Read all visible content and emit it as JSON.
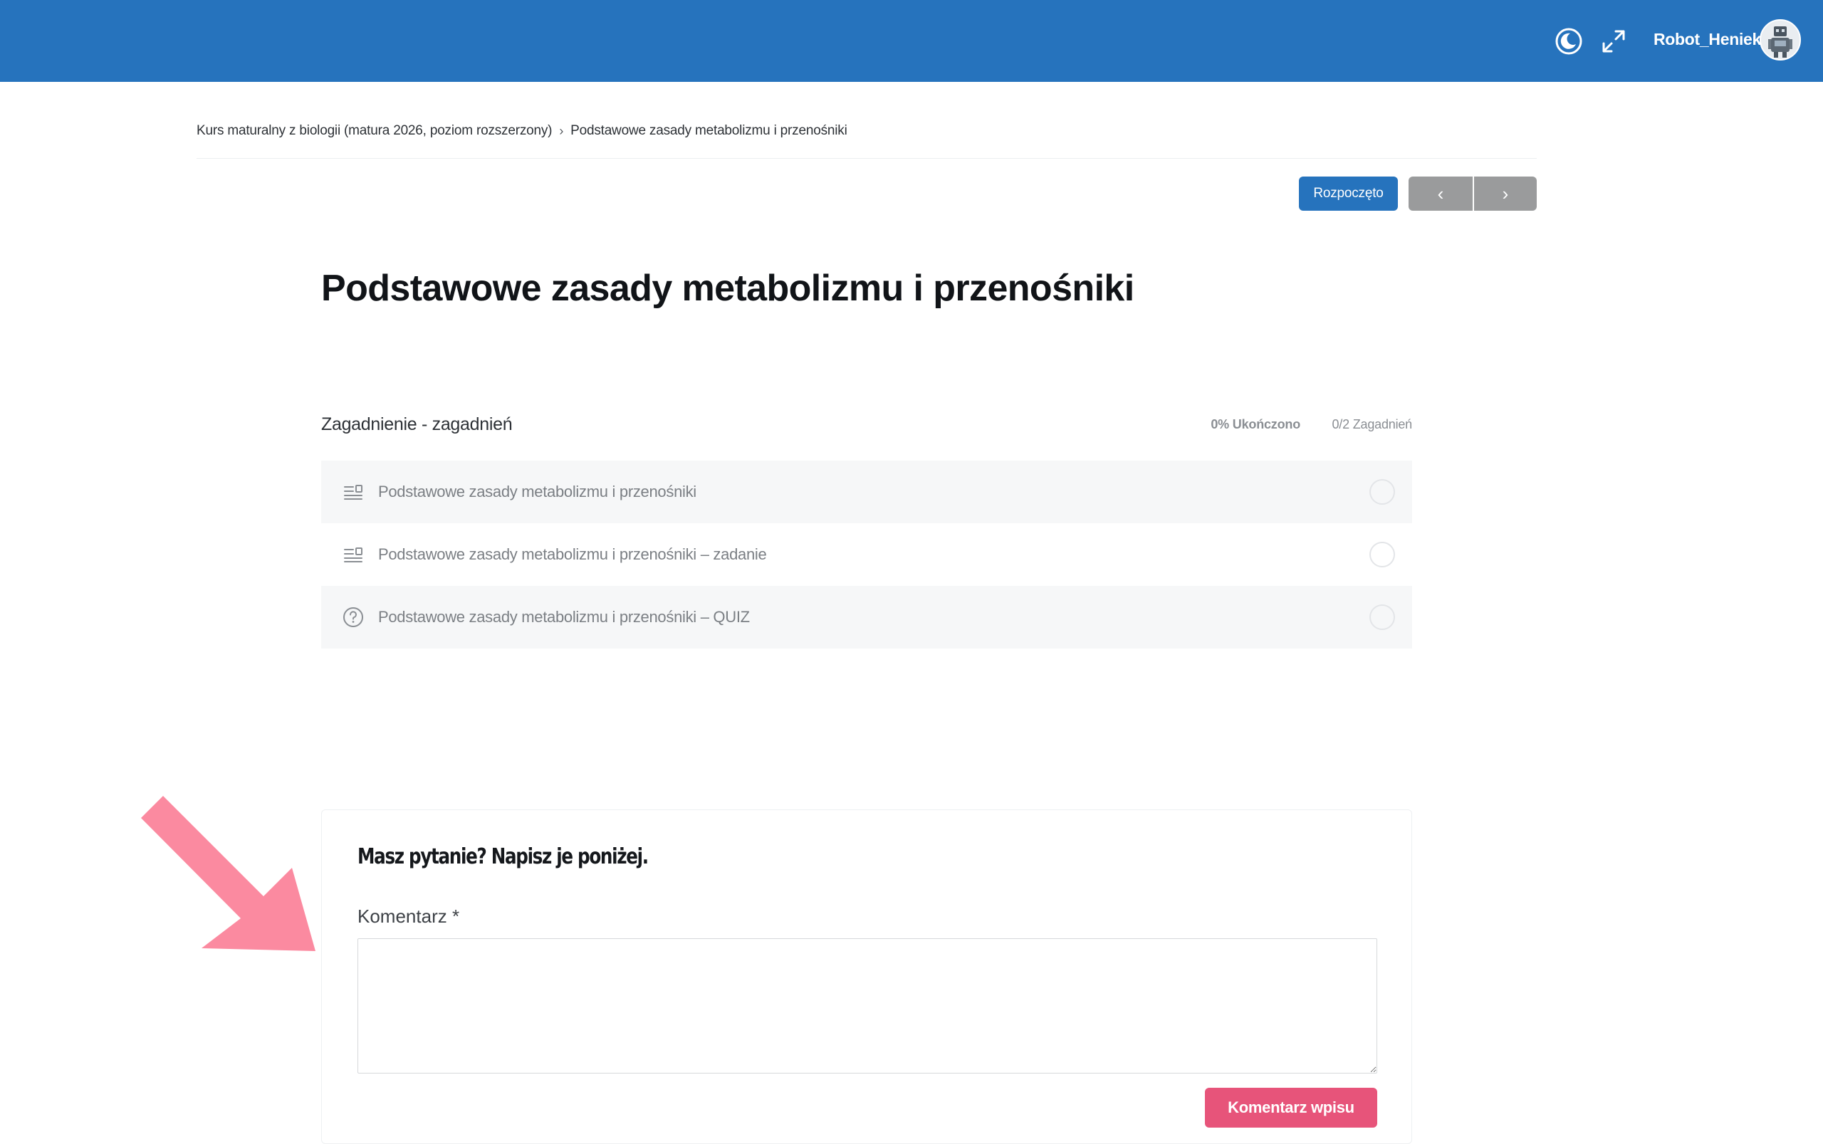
{
  "topbar": {
    "username": "Robot_Heniek",
    "icons": [
      "moon-icon",
      "expand-icon",
      "avatar"
    ],
    "background": "#2673bd"
  },
  "breadcrumb": {
    "course": "Kurs maturalny z biologii (matura 2026, poziom rozszerzony)",
    "separator": "›",
    "lesson": "Podstawowe zasady metabolizmu i przenośniki"
  },
  "actions": {
    "status_label": "Rozpoczęto",
    "prev_symbol": "‹",
    "next_symbol": "›"
  },
  "lesson": {
    "title": "Podstawowe zasady metabolizmu i przenośniki"
  },
  "topics": {
    "heading": "Zagadnienie - zagadnień",
    "progress": "0% Ukończono",
    "count": "0/2 Zagadnień",
    "items": [
      {
        "label": "Podstawowe zasady metabolizmu i przenośniki",
        "icon": "lesson-text-icon",
        "completed": false
      },
      {
        "label": "Podstawowe zasady metabolizmu i przenośniki – zadanie",
        "icon": "lesson-text-icon",
        "completed": false
      },
      {
        "label": "Podstawowe zasady metabolizmu i przenośniki – QUIZ",
        "icon": "quiz-question-icon",
        "completed": false
      }
    ]
  },
  "comment": {
    "heading": "Masz pytanie? Napisz je poniżej.",
    "label": "Komentarz *",
    "textarea_value": "",
    "submit_label": "Komentarz wpisu",
    "accent": "#e7547a"
  },
  "annotation": {
    "arrow_color": "#fb8aa0"
  }
}
